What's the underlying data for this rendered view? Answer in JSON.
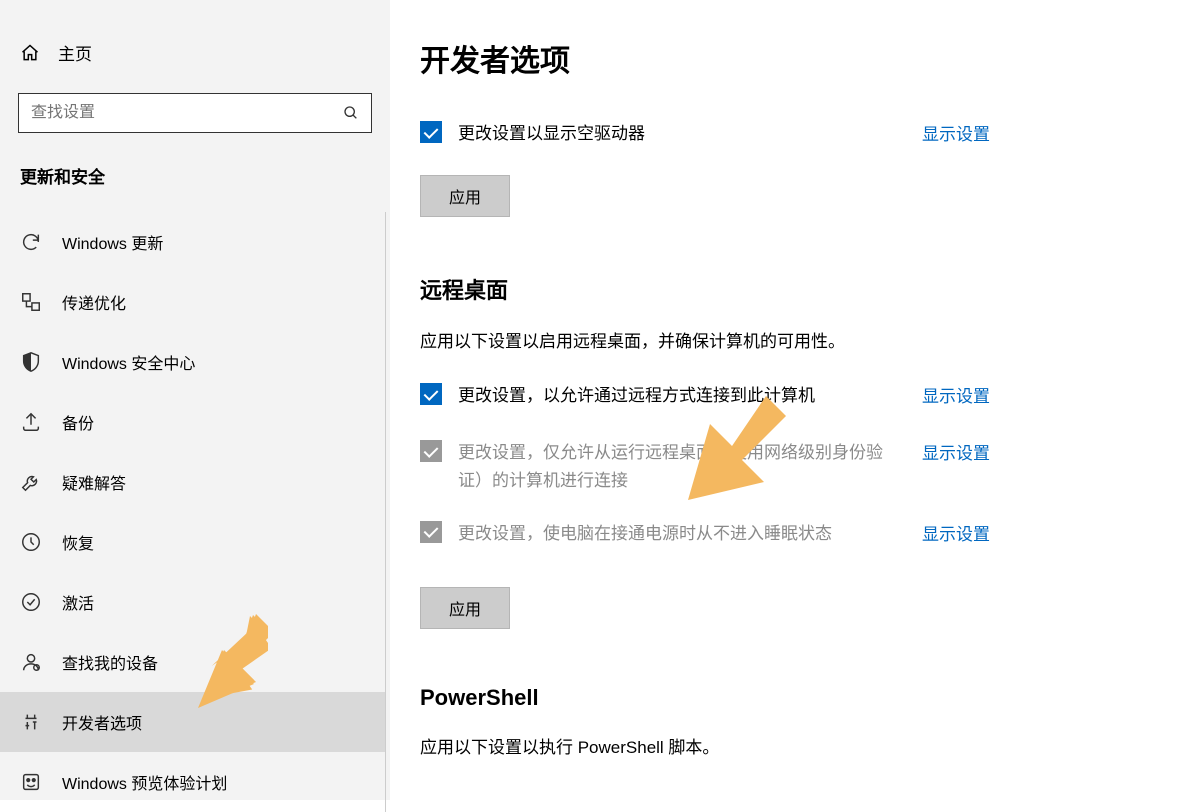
{
  "colors": {
    "accent": "#0067c0",
    "sidebar_bg": "#f3f3f3",
    "selected_bg": "#d9d9d9",
    "arrow": "#f4b860"
  },
  "sidebar": {
    "home_label": "主页",
    "search_placeholder": "查找设置",
    "category_label": "更新和安全",
    "items": [
      {
        "label": "Windows 更新",
        "icon": "sync"
      },
      {
        "label": "传递优化",
        "icon": "delivery"
      },
      {
        "label": "Windows 安全中心",
        "icon": "shield"
      },
      {
        "label": "备份",
        "icon": "backup"
      },
      {
        "label": "疑难解答",
        "icon": "troubleshoot"
      },
      {
        "label": "恢复",
        "icon": "recovery"
      },
      {
        "label": "激活",
        "icon": "activate"
      },
      {
        "label": "查找我的设备",
        "icon": "find"
      },
      {
        "label": "开发者选项",
        "icon": "dev",
        "selected": true
      },
      {
        "label": "Windows 预览体验计划",
        "icon": "insider"
      }
    ]
  },
  "main": {
    "title": "开发者选项",
    "section1": {
      "row1_label": "更改设置以显示空驱动器",
      "show_settings": "显示设置",
      "apply": "应用"
    },
    "section2": {
      "title": "远程桌面",
      "desc": "应用以下设置以启用远程桌面，并确保计算机的可用性。",
      "row1_label": "更改设置，以允许通过远程方式连接到此计算机",
      "row2_label": "更改设置，仅允许从运行远程桌面且使用网络级别身份验证）的计算机进行连接",
      "row3_label": "更改设置，使电脑在接通电源时从不进入睡眠状态",
      "show_settings": "显示设置",
      "apply": "应用"
    },
    "section3": {
      "title": "PowerShell",
      "desc": "应用以下设置以执行 PowerShell 脚本。"
    }
  }
}
